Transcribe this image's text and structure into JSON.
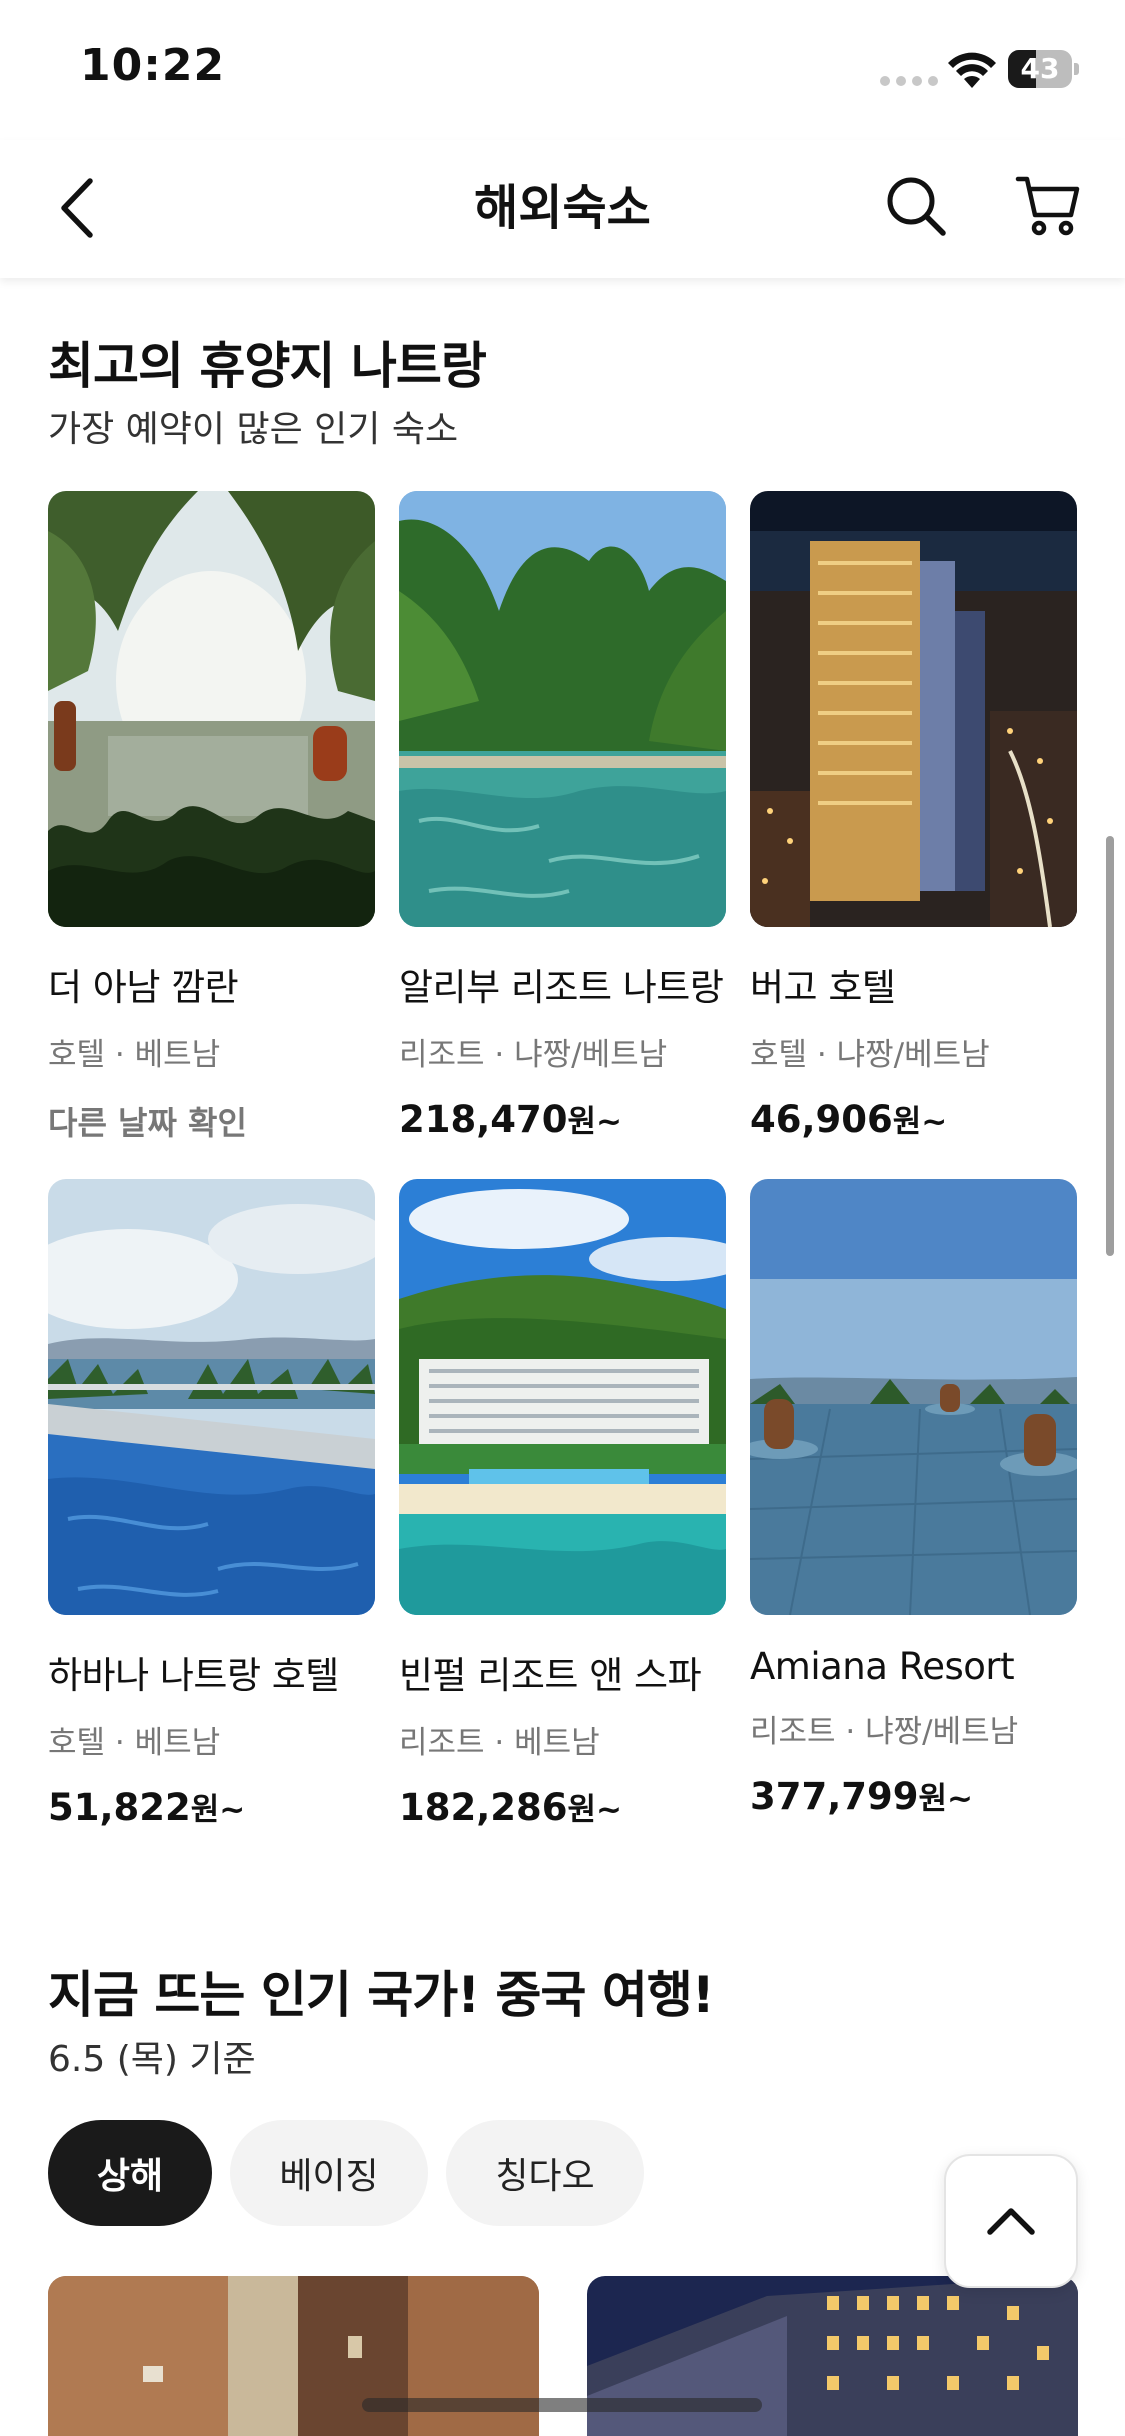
{
  "status_bar": {
    "time": "10:22",
    "battery": "43",
    "battery_level": 0.43
  },
  "nav": {
    "title": "해외숙소"
  },
  "section1": {
    "title": "최고의 휴양지 나트랑",
    "subtitle": "가장 예약이 많은 인기 숙소",
    "cards": [
      {
        "name": "더 아남 깜란",
        "meta": "호텔 · 베트남",
        "check": "다른 날짜 확인"
      },
      {
        "name": "알리부 리조트 나트랑",
        "meta": "리조트 · 냐짱/베트남",
        "price": "218,470",
        "unit": "원~"
      },
      {
        "name": "버고 호텔",
        "meta": "호텔 · 냐짱/베트남",
        "price": "46,906",
        "unit": "원~"
      },
      {
        "name": "하바나 나트랑 호텔",
        "meta": "호텔 · 베트남",
        "price": "51,822",
        "unit": "원~"
      },
      {
        "name": "빈펄 리조트 앤 스파",
        "meta": "리조트 · 베트남",
        "price": "182,286",
        "unit": "원~"
      },
      {
        "name": "Amiana Resort",
        "meta": "리조트 · 냐짱/베트남",
        "price": "377,799",
        "unit": "원~"
      }
    ]
  },
  "section2": {
    "title": "지금 뜨는 인기 국가! 중국 여행!",
    "subtitle": "6.5 (목) 기준",
    "chips": [
      "상해",
      "베이징",
      "칭다오"
    ],
    "selected_chip": "상해"
  }
}
